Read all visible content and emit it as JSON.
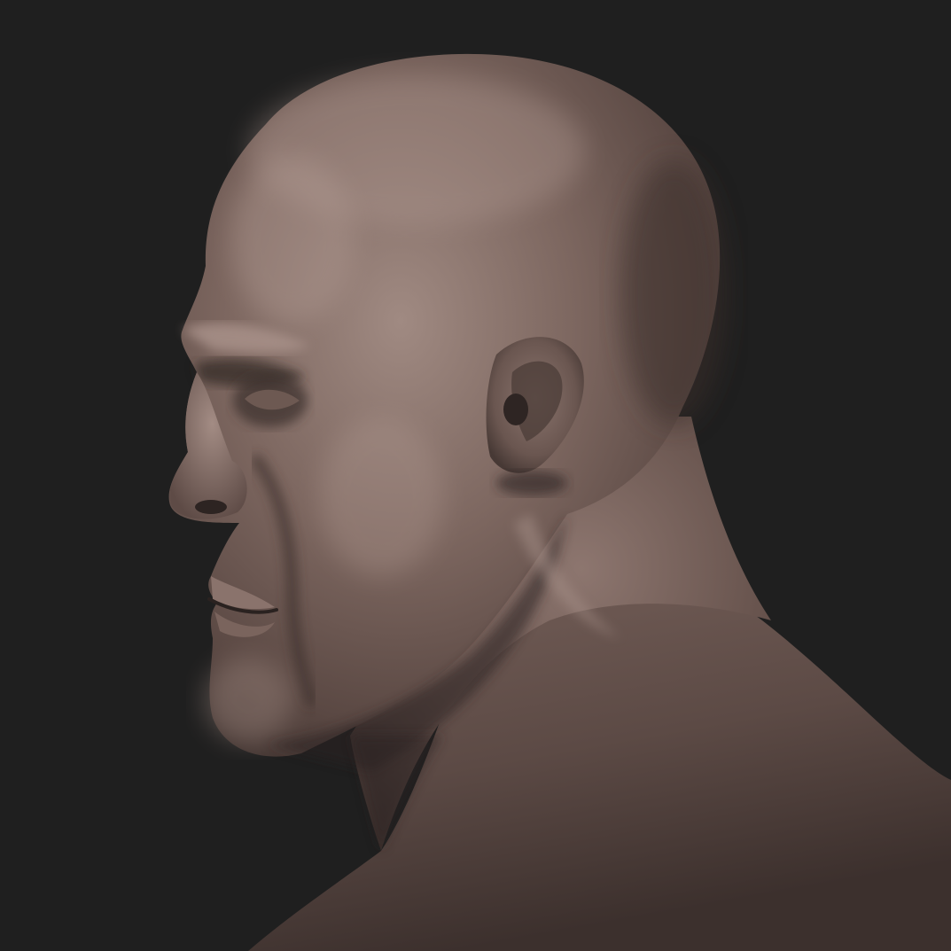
{
  "scene": {
    "subject": "sculpted-bust-profile",
    "colors": {
      "background": "#1f1f1f",
      "clay_shadow": "#2f2624",
      "clay_dark": "#4a3b36",
      "clay_mid": "#705b54",
      "clay_light": "#9a847c",
      "clay_highlight": "#c2aca4"
    }
  }
}
